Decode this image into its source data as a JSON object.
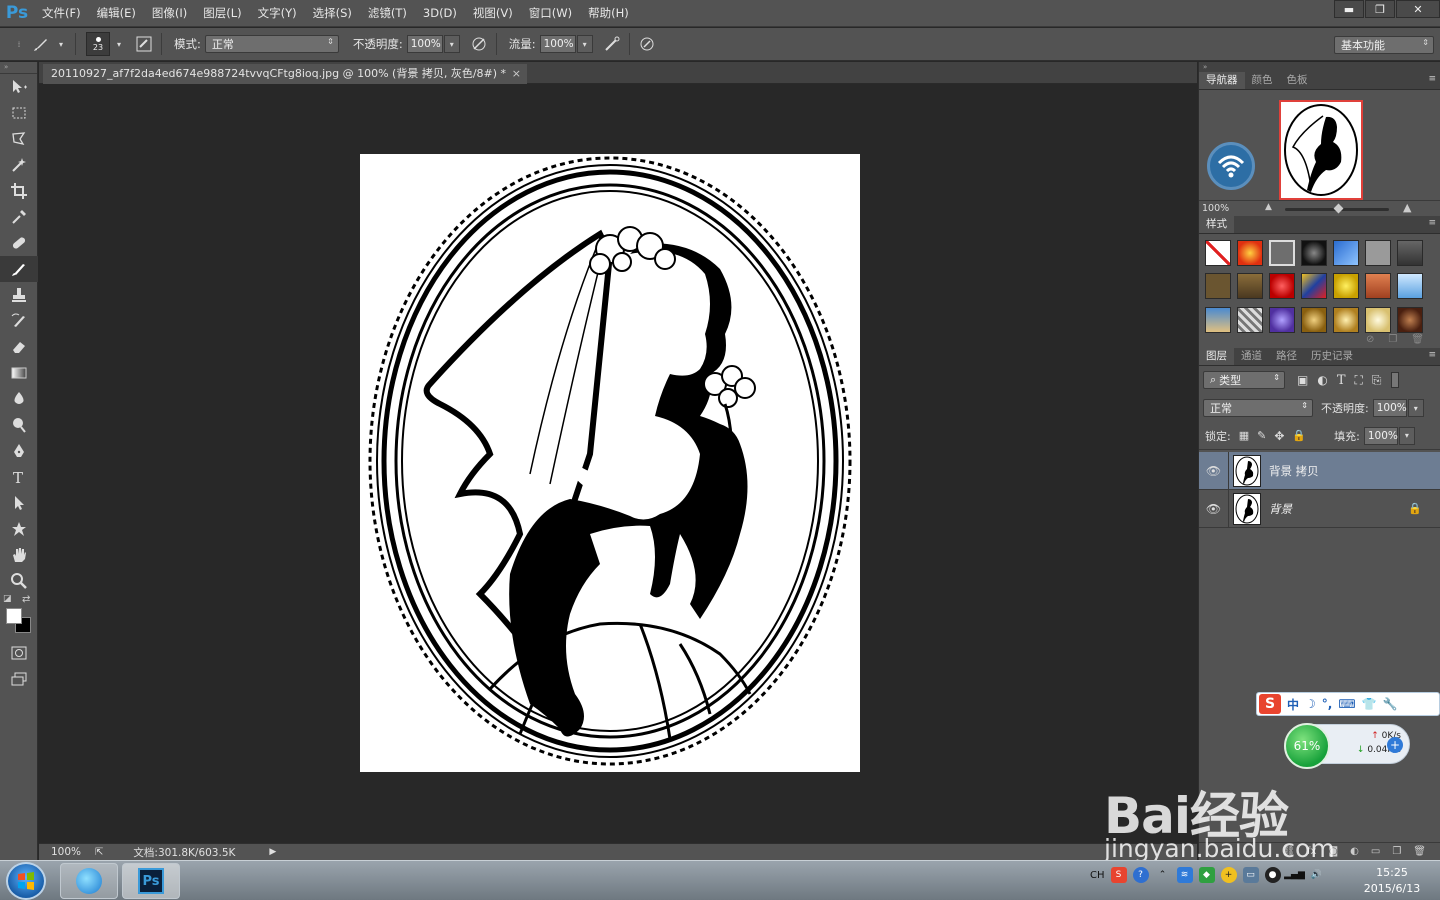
{
  "app": {
    "logo": "Ps"
  },
  "menubar": {
    "items": [
      "文件(F)",
      "编辑(E)",
      "图像(I)",
      "图层(L)",
      "文字(Y)",
      "选择(S)",
      "滤镜(T)",
      "3D(D)",
      "视图(V)",
      "窗口(W)",
      "帮助(H)"
    ]
  },
  "window_controls": {
    "minimize": "▬",
    "restore": "❐",
    "close": "✕"
  },
  "options": {
    "brush_size": "23",
    "mode_label": "模式:",
    "mode_value": "正常",
    "opacity_label": "不透明度:",
    "opacity_value": "100%",
    "flow_label": "流量:",
    "flow_value": "100%",
    "workspace": "基本功能"
  },
  "document": {
    "tab_title": "20110927_af7f2da4ed674e988724tvvqCFtg8ioq.jpg @ 100% (背景 拷贝, 灰色/8#) *",
    "close": "×"
  },
  "status": {
    "zoom": "100%",
    "doc_size": "文档:301.8K/603.5K"
  },
  "navigator": {
    "tabs": [
      "导航器",
      "颜色",
      "色板"
    ],
    "zoom": "100%"
  },
  "styles": {
    "tab": "样式"
  },
  "layers_panel": {
    "tabs": [
      "图层",
      "通道",
      "路径",
      "历史记录"
    ],
    "filter": "类型",
    "blend_mode": "正常",
    "opacity_label": "不透明度:",
    "opacity_value": "100%",
    "lock_label": "锁定:",
    "fill_label": "填充:",
    "fill_value": "100%",
    "layers": [
      {
        "name": "背景 拷贝",
        "selected": true,
        "locked": false
      },
      {
        "name": "背景",
        "selected": false,
        "locked": true
      }
    ]
  },
  "sogou": {
    "logo": "S",
    "items": [
      "中",
      "☽",
      "°,",
      "⌨",
      "👕",
      "🔧"
    ]
  },
  "speed": {
    "percent": "61%",
    "up": "0K/s",
    "down": "0.04K/s"
  },
  "watermark": {
    "logo": "Bai经验",
    "url": "jingyan.baidu.com"
  },
  "tray": {
    "lang": "CH",
    "time": "15:25",
    "date": "2015/6/13"
  },
  "colors": {
    "accent": "#3a9ad9",
    "panel": "#535353",
    "canvas": "#282828",
    "selected_layer": "#6d7d93"
  }
}
